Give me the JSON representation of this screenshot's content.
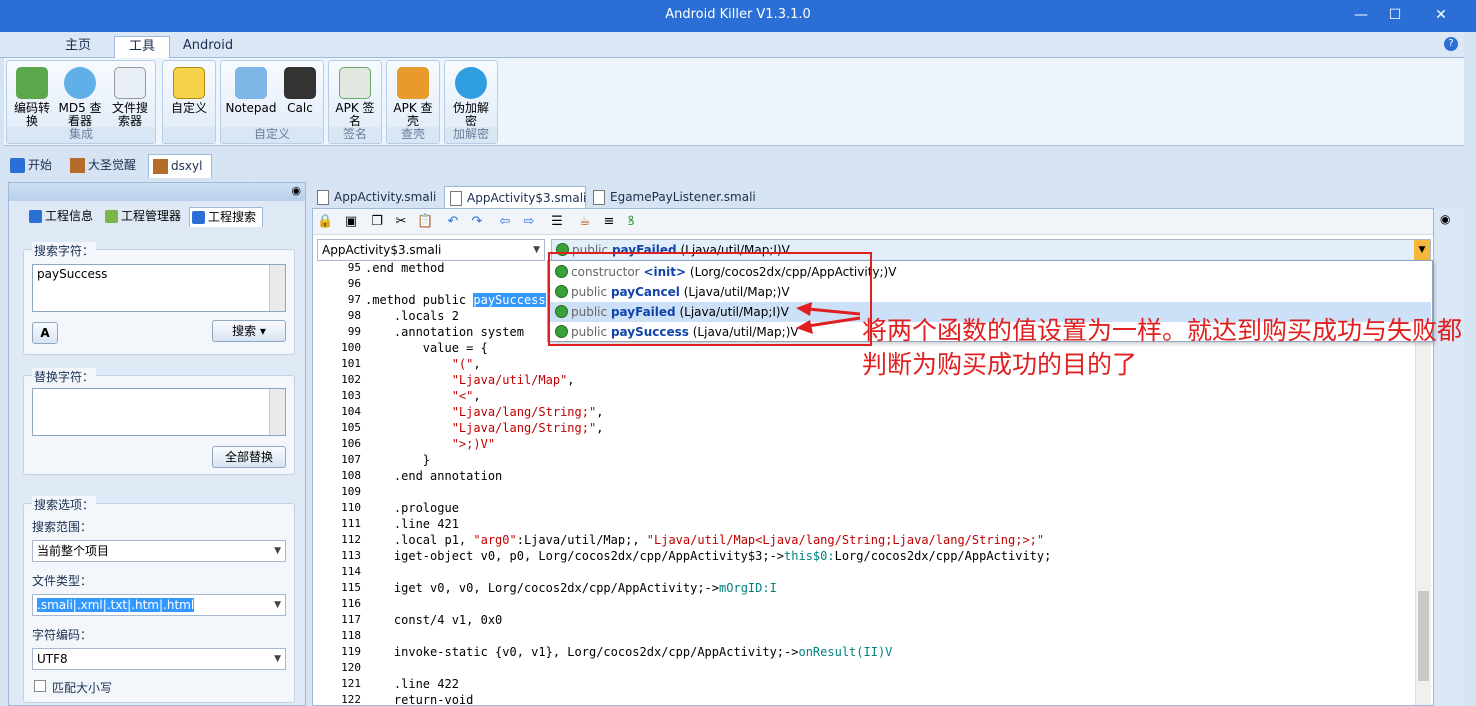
{
  "window": {
    "title": "Android Killer V1.3.1.0",
    "min": "—",
    "max": "☐",
    "close": "✕"
  },
  "ribbon_tabs": [
    "主页",
    "工具",
    "Android"
  ],
  "ribbon": {
    "groups": [
      {
        "caption": "集成",
        "buttons": [
          "编码转换",
          "MD5 查看器",
          "文件搜索器"
        ]
      },
      {
        "caption": "",
        "buttons": [
          "自定义"
        ]
      },
      {
        "caption": "自定义",
        "buttons": [
          "Notepad",
          "Calc"
        ]
      },
      {
        "caption": "签名",
        "buttons": [
          "APK 签名"
        ]
      },
      {
        "caption": "查壳",
        "buttons": [
          "APK 查壳"
        ]
      },
      {
        "caption": "加解密",
        "buttons": [
          "伪加解密"
        ]
      }
    ]
  },
  "doc_tabs": [
    "开始",
    "大圣觉醒",
    "dsxyl"
  ],
  "left_panel": {
    "tabs": [
      "工程信息",
      "工程管理器",
      "工程搜索"
    ],
    "search_label": "搜索字符：",
    "search_value": "paySuccess",
    "search_button": "搜索",
    "replace_label": "替换字符：",
    "replace_value": "",
    "replace_all_button": "全部替换",
    "options_label": "搜索选项：",
    "scope_label": "搜索范围：",
    "scope_value": "当前整个项目",
    "filetype_label": "文件类型：",
    "filetype_value": ".smali|.xml|.txt|.htm|.html",
    "encoding_label": "字符编码：",
    "encoding_value": "UTF8",
    "match_case_label": "匹配大小写"
  },
  "editor_tabs": [
    "AppActivity.smali",
    "AppActivity$3.smali",
    "EgamePayListener.smali"
  ],
  "editor": {
    "class_combo": "AppActivity$3.smali",
    "method_combo": {
      "mod": "public",
      "name": "payFailed",
      "sig": "(Ljava/util/Map;I)V"
    },
    "dropdown": [
      {
        "mod": "constructor",
        "name": "<init>",
        "sig": "(Lorg/cocos2dx/cpp/AppActivity;)V"
      },
      {
        "mod": "public",
        "name": "payCancel",
        "sig": "(Ljava/util/Map;)V"
      },
      {
        "mod": "public",
        "name": "payFailed",
        "sig": "(Ljava/util/Map;I)V"
      },
      {
        "mod": "public",
        "name": "paySuccess",
        "sig": "(Ljava/util/Map;)V"
      }
    ],
    "lines": [
      {
        "n": "95",
        "t": ".end method"
      },
      {
        "n": "96",
        "t": ""
      },
      {
        "n": "97",
        "t": ".method public paySuccess(Ljava/util/Map;)V"
      },
      {
        "n": "98",
        "t": "    .locals 2"
      },
      {
        "n": "99",
        "t": "    .annotation system"
      },
      {
        "n": "100",
        "t": "        value = {"
      },
      {
        "n": "101",
        "t": "            \"(\","
      },
      {
        "n": "102",
        "t": "            \"Ljava/util/Map\","
      },
      {
        "n": "103",
        "t": "            \"<\","
      },
      {
        "n": "104",
        "t": "            \"Ljava/lang/String;\","
      },
      {
        "n": "105",
        "t": "            \"Ljava/lang/String;\","
      },
      {
        "n": "106",
        "t": "            \">;)V\""
      },
      {
        "n": "107",
        "t": "        }"
      },
      {
        "n": "108",
        "t": "    .end annotation"
      },
      {
        "n": "109",
        "t": ""
      },
      {
        "n": "110",
        "t": "    .prologue"
      },
      {
        "n": "111",
        "t": "    .line 421"
      },
      {
        "n": "112",
        "t": "    .local p1, \"arg0\":Ljava/util/Map;, \"Ljava/util/Map<Ljava/lang/String;Ljava/lang/String;>;\""
      },
      {
        "n": "113",
        "t": "    iget-object v0, p0, Lorg/cocos2dx/cpp/AppActivity$3;->this$0:Lorg/cocos2dx/cpp/AppActivity;"
      },
      {
        "n": "114",
        "t": ""
      },
      {
        "n": "115",
        "t": "    iget v0, v0, Lorg/cocos2dx/cpp/AppActivity;->mOrgID:I"
      },
      {
        "n": "116",
        "t": ""
      },
      {
        "n": "117",
        "t": "    const/4 v1, 0x0"
      },
      {
        "n": "118",
        "t": ""
      },
      {
        "n": "119",
        "t": "    invoke-static {v0, v1}, Lorg/cocos2dx/cpp/AppActivity;->onResult(II)V"
      },
      {
        "n": "120",
        "t": ""
      },
      {
        "n": "121",
        "t": "    .line 422"
      },
      {
        "n": "122",
        "t": "    return-void"
      }
    ]
  },
  "annotation": "将两个函数的值设置为一样。就达到购买成功与失败都判断为购买成功的目的了",
  "colors": {
    "accent": "#2b6fd6",
    "annotation": "#e02020"
  }
}
